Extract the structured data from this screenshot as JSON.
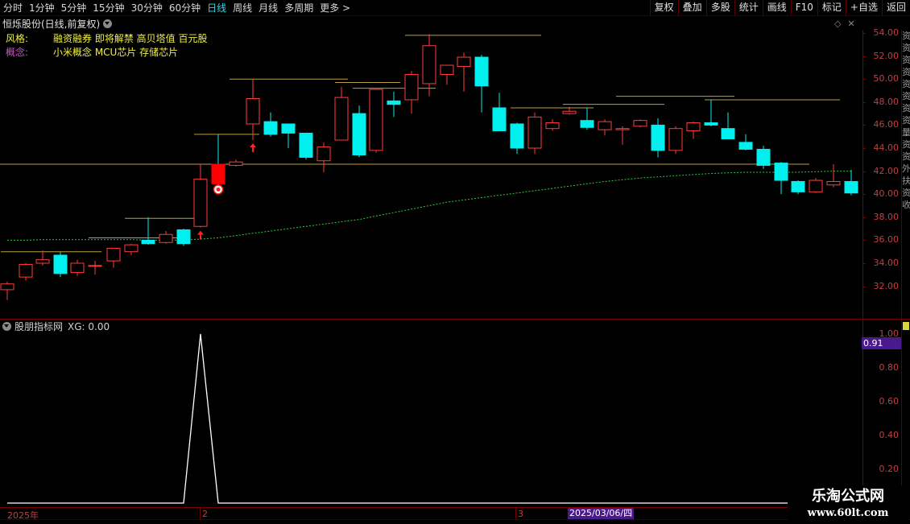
{
  "toolbar": {
    "periods": [
      {
        "label": "分时",
        "active": false
      },
      {
        "label": "1分钟",
        "active": false
      },
      {
        "label": "5分钟",
        "active": false
      },
      {
        "label": "15分钟",
        "active": false
      },
      {
        "label": "30分钟",
        "active": false
      },
      {
        "label": "60分钟",
        "active": false
      },
      {
        "label": "日线",
        "active": true
      },
      {
        "label": "周线",
        "active": false
      },
      {
        "label": "月线",
        "active": false
      },
      {
        "label": "多周期",
        "active": false
      },
      {
        "label": "更多 >",
        "active": false
      }
    ],
    "right_buttons": [
      "复权",
      "叠加",
      "多股",
      "统计",
      "画线",
      "F10",
      "标记",
      "+自选",
      "返回"
    ]
  },
  "stock": {
    "title": "恒烁股份(日线,前复权)",
    "style_label": "风格:",
    "style_value": "融资融券 即将解禁 高贝塔值 百元股",
    "concept_label": "概念:",
    "concept_value": "小米概念 MCU芯片 存储芯片"
  },
  "price_axis": {
    "ticks": [
      "54.00",
      "52.00",
      "50.00",
      "48.00",
      "46.00",
      "44.00",
      "42.00",
      "40.00",
      "38.00",
      "36.00",
      "34.00",
      "32.00"
    ]
  },
  "indicator": {
    "title": "股朋指标网",
    "xg_label": "XG: 0.00",
    "xg_badge": "0.91",
    "ticks": [
      "1.00",
      "0.80",
      "0.60",
      "0.40",
      "0.20"
    ],
    "signal_values": [
      0,
      0,
      0,
      0,
      0,
      0,
      0,
      0,
      0,
      0,
      0,
      1,
      0,
      0,
      0,
      0,
      0,
      0,
      0,
      0,
      0,
      0,
      0,
      0,
      0,
      0,
      0,
      0,
      0,
      0,
      0,
      0,
      0,
      0,
      0,
      0,
      0,
      0,
      0,
      0,
      0,
      0,
      0,
      0,
      0,
      0,
      0,
      0
    ]
  },
  "time_axis": {
    "year_label": "2025年",
    "month_labels": [
      "2",
      "3"
    ],
    "cursor_date": "2025/03/06/四"
  },
  "side_strip": [
    "资",
    "资",
    "资",
    "资",
    "资",
    "资",
    "资",
    "资",
    "量",
    "资",
    "资",
    "外",
    "扶",
    "资",
    "收"
  ],
  "watermark": {
    "title": "乐淘公式网",
    "url": "www.60lt.com"
  },
  "colors": {
    "up": "#ff3c3c",
    "down": "#00f0f0",
    "ma": "#2ecc40",
    "resistance": "#b8a040",
    "signal_fill": "#ff1010"
  },
  "chart_data": {
    "type": "candlestick",
    "price_range": [
      30.5,
      55.0
    ],
    "candles": [
      {
        "o": 31.7,
        "h": 32.4,
        "l": 30.8,
        "c": 32.2
      },
      {
        "o": 32.8,
        "h": 34.0,
        "l": 32.5,
        "c": 33.9
      },
      {
        "o": 34.0,
        "h": 35.1,
        "l": 33.8,
        "c": 34.3
      },
      {
        "o": 34.7,
        "h": 35.0,
        "l": 32.8,
        "c": 33.1
      },
      {
        "o": 33.2,
        "h": 34.3,
        "l": 32.9,
        "c": 34.0
      },
      {
        "o": 33.8,
        "h": 34.2,
        "l": 33.0,
        "c": 33.8
      },
      {
        "o": 34.2,
        "h": 35.3,
        "l": 33.6,
        "c": 35.3
      },
      {
        "o": 35.0,
        "h": 35.7,
        "l": 34.7,
        "c": 35.6
      },
      {
        "o": 36.0,
        "h": 38.0,
        "l": 35.6,
        "c": 35.7
      },
      {
        "o": 35.8,
        "h": 36.8,
        "l": 35.7,
        "c": 36.5
      },
      {
        "o": 36.9,
        "h": 37.0,
        "l": 35.5,
        "c": 35.7
      },
      {
        "o": 37.2,
        "h": 42.6,
        "l": 37.1,
        "c": 41.3
      },
      {
        "o": 42.6,
        "h": 45.2,
        "l": 40.6,
        "c": 40.9
      },
      {
        "o": 42.5,
        "h": 43.0,
        "l": 42.4,
        "c": 42.8
      },
      {
        "o": 46.1,
        "h": 50.0,
        "l": 44.7,
        "c": 48.3
      },
      {
        "o": 46.3,
        "h": 47.1,
        "l": 45.0,
        "c": 45.2
      },
      {
        "o": 46.1,
        "h": 46.1,
        "l": 44.0,
        "c": 45.3
      },
      {
        "o": 45.3,
        "h": 45.3,
        "l": 43.0,
        "c": 43.2
      },
      {
        "o": 42.9,
        "h": 44.5,
        "l": 41.9,
        "c": 44.1
      },
      {
        "o": 44.7,
        "h": 49.3,
        "l": 44.7,
        "c": 48.4
      },
      {
        "o": 47.0,
        "h": 47.7,
        "l": 43.2,
        "c": 43.4
      },
      {
        "o": 43.8,
        "h": 49.2,
        "l": 43.6,
        "c": 49.1
      },
      {
        "o": 48.1,
        "h": 48.9,
        "l": 46.7,
        "c": 47.8
      },
      {
        "o": 48.2,
        "h": 50.7,
        "l": 47.0,
        "c": 50.4
      },
      {
        "o": 49.6,
        "h": 53.9,
        "l": 48.5,
        "c": 52.9
      },
      {
        "o": 50.4,
        "h": 51.0,
        "l": 49.5,
        "c": 51.2
      },
      {
        "o": 51.1,
        "h": 52.3,
        "l": 48.9,
        "c": 51.9
      },
      {
        "o": 51.9,
        "h": 52.1,
        "l": 47.1,
        "c": 49.4
      },
      {
        "o": 47.5,
        "h": 48.8,
        "l": 45.5,
        "c": 45.5
      },
      {
        "o": 46.1,
        "h": 46.2,
        "l": 43.5,
        "c": 44.0
      },
      {
        "o": 44.0,
        "h": 47.1,
        "l": 43.5,
        "c": 46.7
      },
      {
        "o": 45.7,
        "h": 46.5,
        "l": 45.5,
        "c": 46.2
      },
      {
        "o": 47.0,
        "h": 47.6,
        "l": 46.9,
        "c": 47.2
      },
      {
        "o": 46.4,
        "h": 47.5,
        "l": 45.6,
        "c": 45.8
      },
      {
        "o": 45.6,
        "h": 46.5,
        "l": 45.1,
        "c": 46.3
      },
      {
        "o": 45.6,
        "h": 45.9,
        "l": 44.3,
        "c": 45.7
      },
      {
        "o": 45.9,
        "h": 46.5,
        "l": 45.8,
        "c": 46.4
      },
      {
        "o": 46.0,
        "h": 46.6,
        "l": 43.2,
        "c": 43.8
      },
      {
        "o": 43.8,
        "h": 45.9,
        "l": 43.5,
        "c": 45.7
      },
      {
        "o": 45.5,
        "h": 46.3,
        "l": 44.8,
        "c": 46.2
      },
      {
        "o": 46.2,
        "h": 48.2,
        "l": 45.9,
        "c": 46.0
      },
      {
        "o": 45.7,
        "h": 47.1,
        "l": 44.8,
        "c": 44.8
      },
      {
        "o": 44.5,
        "h": 45.2,
        "l": 43.8,
        "c": 43.9
      },
      {
        "o": 43.9,
        "h": 44.2,
        "l": 42.2,
        "c": 42.5
      },
      {
        "o": 42.7,
        "h": 42.8,
        "l": 40.0,
        "c": 41.2
      },
      {
        "o": 41.1,
        "h": 41.2,
        "l": 40.0,
        "c": 40.2
      },
      {
        "o": 40.2,
        "h": 41.4,
        "l": 40.1,
        "c": 41.2
      },
      {
        "o": 40.8,
        "h": 42.6,
        "l": 40.6,
        "c": 41.1
      },
      {
        "o": 41.1,
        "h": 42.1,
        "l": 39.9,
        "c": 40.1
      }
    ],
    "ma": [
      36.0,
      36.0,
      36.05,
      36.05,
      36.05,
      36.05,
      36.05,
      36.05,
      36.0,
      36.0,
      36.0,
      36.1,
      36.2,
      36.4,
      36.6,
      36.8,
      37.0,
      37.2,
      37.4,
      37.6,
      37.8,
      38.1,
      38.4,
      38.7,
      39.0,
      39.3,
      39.5,
      39.7,
      39.9,
      40.1,
      40.3,
      40.5,
      40.7,
      40.9,
      41.1,
      41.25,
      41.4,
      41.5,
      41.6,
      41.7,
      41.8,
      41.85,
      41.9,
      41.9,
      41.9,
      41.9,
      41.95,
      42.0,
      42.0
    ],
    "resistance_levels": [
      {
        "price": 35.0,
        "from": 0,
        "to": 5
      },
      {
        "price": 36.2,
        "from": 5,
        "to": 10
      },
      {
        "price": 37.9,
        "from": 7,
        "to": 11
      },
      {
        "price": 45.2,
        "from": 11,
        "to": 14
      },
      {
        "price": 50.0,
        "from": 13,
        "to": 19
      },
      {
        "price": 49.7,
        "from": 19,
        "to": 22
      },
      {
        "price": 49.2,
        "from": 20,
        "to": 24
      },
      {
        "price": 53.8,
        "from": 23,
        "to": 30
      },
      {
        "price": 47.5,
        "from": 29,
        "to": 33
      },
      {
        "price": 47.8,
        "from": 32,
        "to": 37
      },
      {
        "price": 48.5,
        "from": 35,
        "to": 41
      },
      {
        "price": 48.2,
        "from": 40,
        "to": 47
      },
      {
        "price": 42.6,
        "from": 46,
        "to": 49
      }
    ],
    "up_arrows": [
      11,
      14
    ],
    "marker_index": 12
  }
}
